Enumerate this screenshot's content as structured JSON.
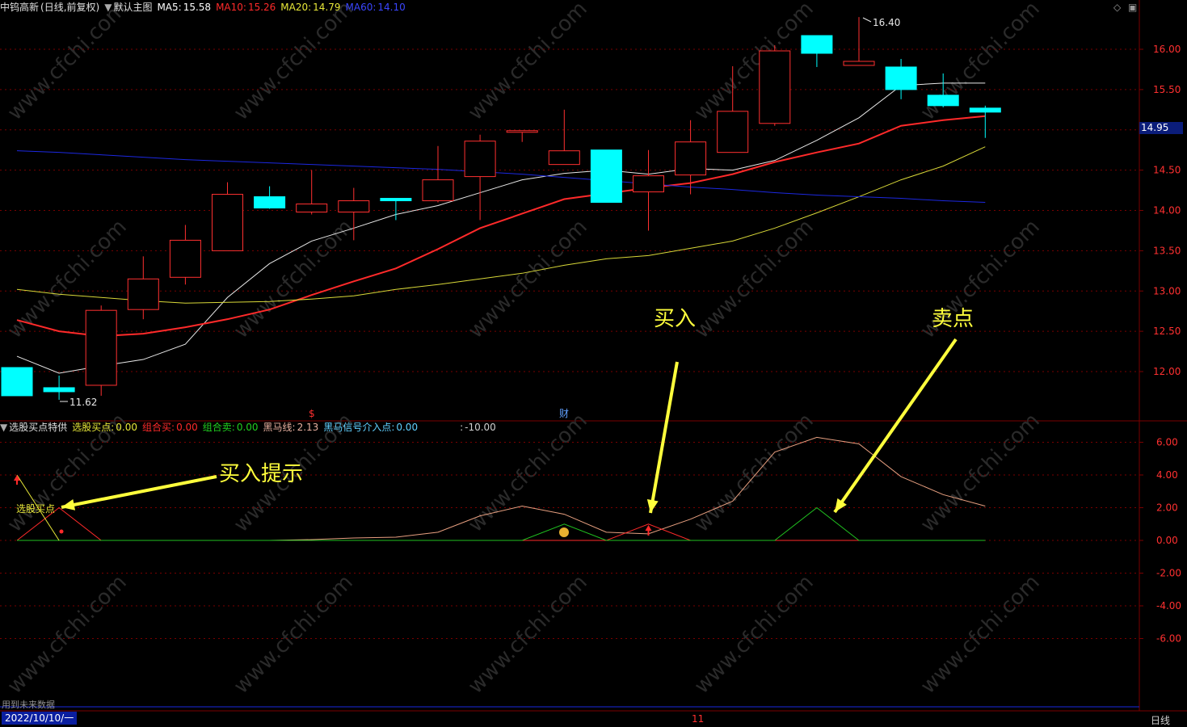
{
  "header": {
    "stock": "中钨高新",
    "mode": "(日线,前复权)",
    "template": "默认主图",
    "ma5": {
      "label": "MA5:",
      "value": "15.58",
      "color": "#ffffff"
    },
    "ma10": {
      "label": "MA10:",
      "value": "15.26",
      "color": "#ff2a2a"
    },
    "ma20": {
      "label": "MA20:",
      "value": "14.79",
      "color": "#e8e838"
    },
    "ma60": {
      "label": "MA60:",
      "value": "14.10",
      "color": "#2a36ff"
    }
  },
  "indicator_header": {
    "name": "选股买点特供",
    "items": [
      {
        "label": "选股买点:",
        "value": "0.00",
        "color": "#e8e838"
      },
      {
        "label": "组合买:",
        "value": "0.00",
        "color": "#ff2a2a"
      },
      {
        "label": "组合卖:",
        "value": "0.00",
        "color": "#20d020"
      },
      {
        "label": "黑马线:",
        "value": "2.13",
        "color": "#e8b0a0"
      },
      {
        "label": "黑马信号介入点:",
        "value": "0.00",
        "color": "#60d0ff"
      },
      {
        "label": ":",
        "value": "-10.00",
        "color": "#d0d0d0"
      }
    ]
  },
  "current_price": "14.95",
  "annotations": {
    "buy_hint": "买入提示",
    "buy": "买入",
    "sell_point": "卖点",
    "pick_point": "选股买点",
    "high_label": "16.40",
    "low_label": "11.62",
    "event_s": "$",
    "event_cai": "财"
  },
  "footer": {
    "note": "用到未来数据",
    "date": "2022/10/10/一",
    "month_mark": "11",
    "period": "日线"
  },
  "colors": {
    "up": "#ff3030",
    "down": "#00ffff",
    "grid": "#7a0000",
    "axis_text": "#ff3030"
  },
  "chart_data": [
    {
      "type": "candlestick",
      "title": "中钨高新 (日线,前复权)",
      "ylim": [
        11.62,
        16.55
      ],
      "yticks": [
        "12.00",
        "12.50",
        "13.00",
        "13.50",
        "14.00",
        "14.50",
        "15.00",
        "15.50",
        "16.00"
      ],
      "candles": [
        {
          "o": 12.05,
          "h": 12.05,
          "l": 11.7,
          "c": 11.7
        },
        {
          "o": 11.8,
          "h": 11.95,
          "l": 11.65,
          "c": 11.75
        },
        {
          "o": 11.83,
          "h": 12.82,
          "l": 11.7,
          "c": 12.76
        },
        {
          "o": 12.77,
          "h": 13.43,
          "l": 12.65,
          "c": 13.15
        },
        {
          "o": 13.17,
          "h": 13.82,
          "l": 13.08,
          "c": 13.63
        },
        {
          "o": 13.5,
          "h": 14.35,
          "l": 13.5,
          "c": 14.2
        },
        {
          "o": 14.17,
          "h": 14.3,
          "l": 14.02,
          "c": 14.03
        },
        {
          "o": 13.98,
          "h": 14.5,
          "l": 13.95,
          "c": 14.08
        },
        {
          "o": 13.98,
          "h": 14.28,
          "l": 13.63,
          "c": 14.12
        },
        {
          "o": 14.15,
          "h": 14.15,
          "l": 13.88,
          "c": 14.12
        },
        {
          "o": 14.12,
          "h": 14.8,
          "l": 14.1,
          "c": 14.38
        },
        {
          "o": 14.42,
          "h": 14.94,
          "l": 13.88,
          "c": 14.86
        },
        {
          "o": 14.98,
          "h": 14.99,
          "l": 14.85,
          "c": 14.99
        },
        {
          "o": 14.57,
          "h": 15.25,
          "l": 14.57,
          "c": 14.74
        },
        {
          "o": 14.75,
          "h": 14.75,
          "l": 14.1,
          "c": 14.1
        },
        {
          "o": 14.23,
          "h": 14.75,
          "l": 13.75,
          "c": 14.43
        },
        {
          "o": 14.44,
          "h": 15.12,
          "l": 14.2,
          "c": 14.85
        },
        {
          "o": 14.72,
          "h": 15.79,
          "l": 14.72,
          "c": 15.23
        },
        {
          "o": 15.08,
          "h": 16.05,
          "l": 15.05,
          "c": 15.98
        },
        {
          "o": 16.17,
          "h": 16.17,
          "l": 15.78,
          "c": 15.95
        },
        {
          "o": 15.8,
          "h": 16.4,
          "l": 15.8,
          "c": 15.85
        },
        {
          "o": 15.78,
          "h": 15.88,
          "l": 15.38,
          "c": 15.5
        },
        {
          "o": 15.43,
          "h": 15.7,
          "l": 15.28,
          "c": 15.3
        },
        {
          "o": 15.27,
          "h": 15.3,
          "l": 14.9,
          "c": 15.22
        }
      ],
      "series": [
        {
          "name": "MA5",
          "color": "#e8e8e8",
          "values": [
            12.19,
            11.98,
            12.07,
            12.15,
            12.34,
            12.92,
            13.34,
            13.62,
            13.78,
            13.95,
            14.06,
            14.22,
            14.38,
            14.46,
            14.5,
            14.45,
            14.52,
            14.5,
            14.62,
            14.87,
            15.15,
            15.55,
            15.58,
            15.58
          ]
        },
        {
          "name": "MA10",
          "color": "#ff2a2a",
          "values": [
            12.64,
            12.5,
            12.44,
            12.47,
            12.55,
            12.65,
            12.77,
            12.95,
            13.12,
            13.28,
            13.52,
            13.78,
            13.96,
            14.14,
            14.21,
            14.28,
            14.34,
            14.45,
            14.6,
            14.72,
            14.83,
            15.05,
            15.12,
            15.17
          ]
        },
        {
          "name": "MA20",
          "color": "#d8d838",
          "values": [
            13.02,
            12.96,
            12.92,
            12.88,
            12.85,
            12.86,
            12.87,
            12.9,
            12.94,
            13.02,
            13.08,
            13.15,
            13.22,
            13.32,
            13.4,
            13.44,
            13.53,
            13.62,
            13.78,
            13.97,
            14.17,
            14.38,
            14.55,
            14.79
          ]
        },
        {
          "name": "MA60",
          "color": "#1c28e0",
          "values": [
            14.74,
            14.72,
            14.69,
            14.66,
            14.63,
            14.61,
            14.59,
            14.57,
            14.55,
            14.53,
            14.51,
            14.48,
            14.45,
            14.41,
            14.37,
            14.33,
            14.29,
            14.26,
            14.22,
            14.19,
            14.17,
            14.15,
            14.12,
            14.1
          ]
        }
      ]
    },
    {
      "type": "line",
      "title": "选股买点特供",
      "ylim": [
        -10.0,
        7.0
      ],
      "yticks": [
        "-6.00",
        "-4.00",
        "-2.00",
        "0.00",
        "2.00",
        "4.00",
        "6.00"
      ],
      "series": [
        {
          "name": "黑马线",
          "color": "#e8a080",
          "values": [
            0,
            0,
            0,
            0,
            0,
            0,
            0,
            0.05,
            0.15,
            0.2,
            0.5,
            1.5,
            2.1,
            1.6,
            0.5,
            0.4,
            1.3,
            2.4,
            5.4,
            6.3,
            5.9,
            3.9,
            2.8,
            2.1
          ]
        },
        {
          "name": "组合买",
          "color": "#ff2a2a",
          "values": [
            0,
            2.0,
            0,
            0,
            0,
            0,
            0,
            0,
            0,
            0,
            0,
            0,
            0,
            0,
            0,
            1.0,
            0,
            0,
            0,
            0,
            0,
            0,
            0,
            0
          ]
        },
        {
          "name": "组合卖",
          "color": "#20c020",
          "values": [
            0,
            0,
            0,
            0,
            0,
            0,
            0,
            0,
            0,
            0,
            0,
            0,
            0,
            1.0,
            0,
            0,
            0,
            0,
            0,
            2.0,
            0,
            0,
            0,
            0
          ]
        },
        {
          "name": "选股买点",
          "color": "#e8e838",
          "values": [
            0,
            4.0,
            0,
            0,
            0,
            0,
            0,
            0,
            0,
            0,
            0,
            0,
            0,
            0,
            0,
            0,
            0,
            0,
            0,
            0,
            0,
            0,
            0,
            0
          ]
        }
      ]
    }
  ]
}
